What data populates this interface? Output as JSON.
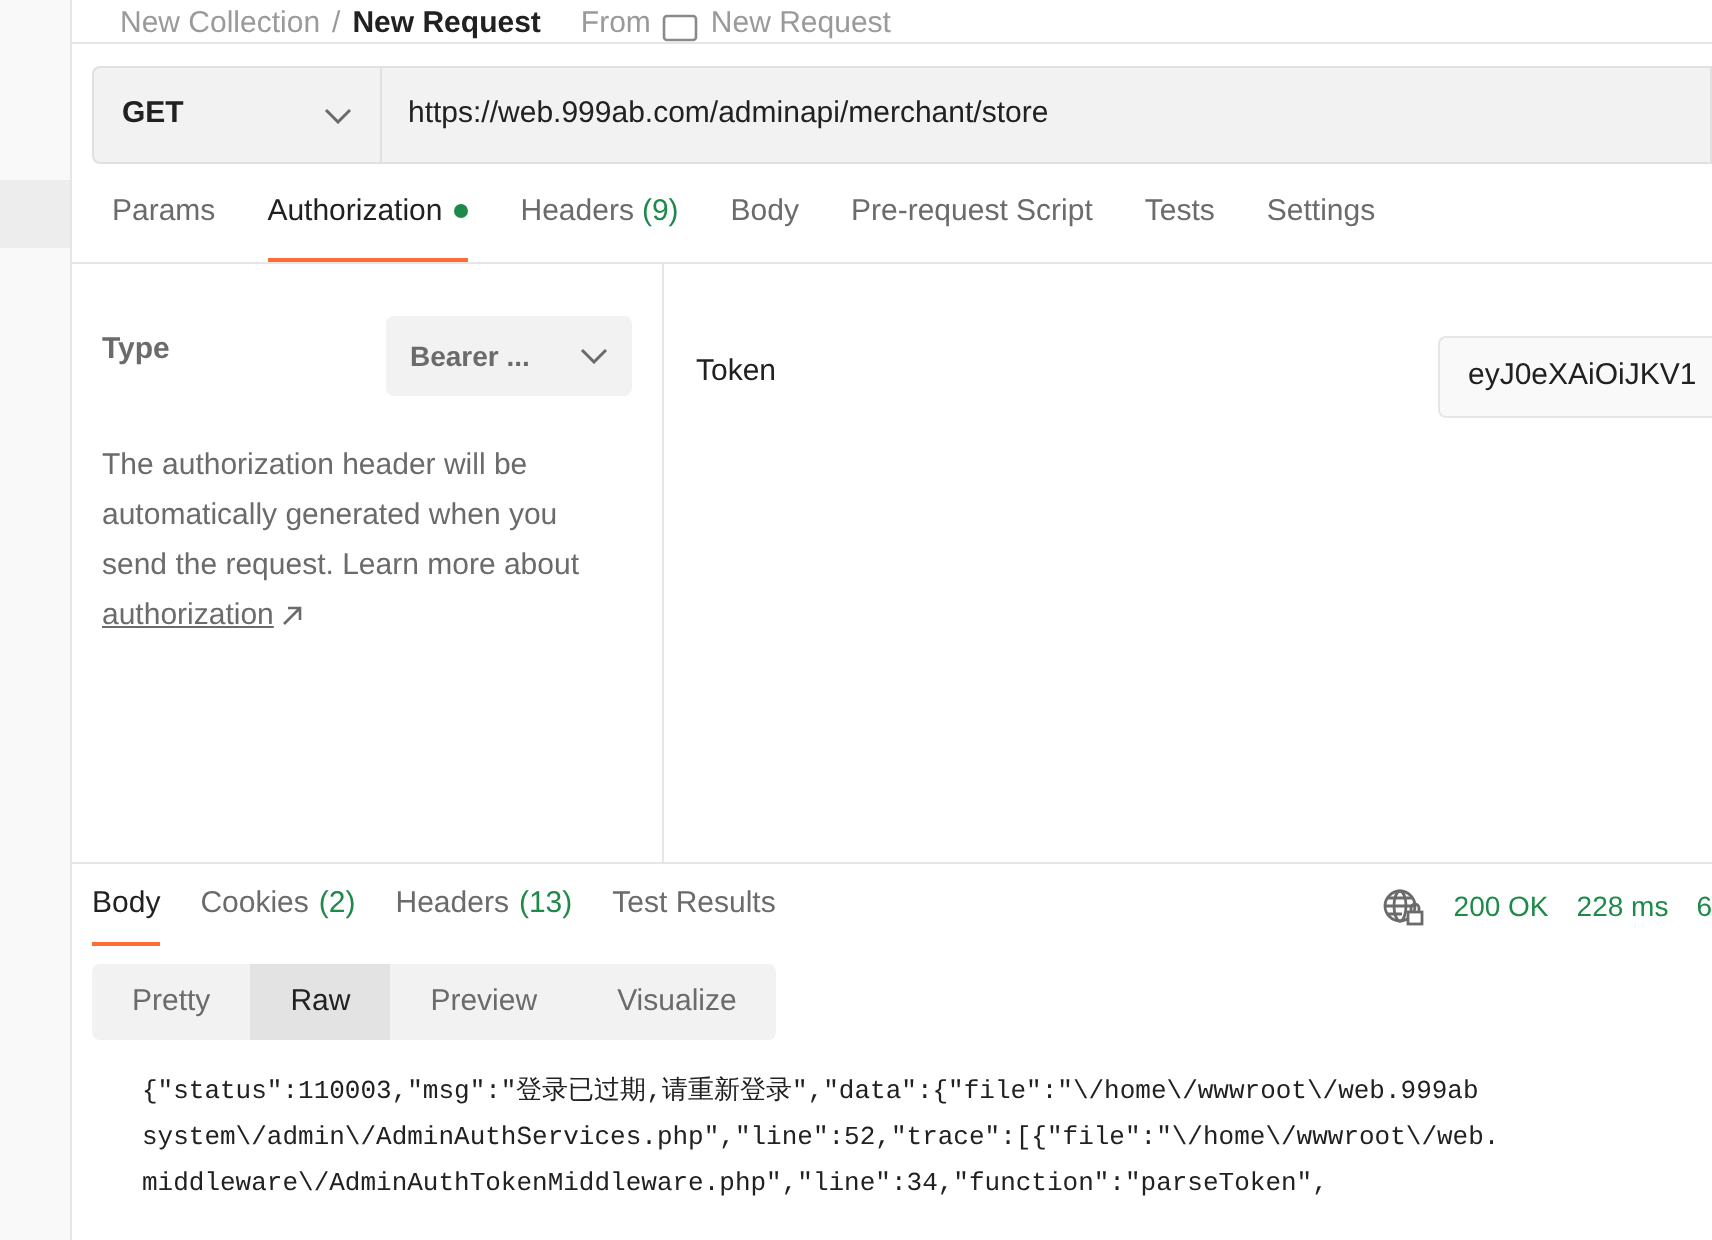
{
  "breadcrumb": {
    "collection": "New Collection",
    "separator": "/",
    "request": "New Request",
    "from_label": "From",
    "source": "New Request"
  },
  "request": {
    "method": "GET",
    "url": "https://web.999ab.com/adminapi/merchant/store"
  },
  "request_tabs": [
    {
      "label": "Params",
      "dot": false,
      "selected": false
    },
    {
      "label": "Authorization",
      "dot": true,
      "selected": true
    },
    {
      "label": "Headers",
      "count": "(9)",
      "dot": false,
      "selected": false
    },
    {
      "label": "Body",
      "dot": false,
      "selected": false
    },
    {
      "label": "Pre-request Script",
      "dot": false,
      "selected": false
    },
    {
      "label": "Tests",
      "dot": false,
      "selected": false
    },
    {
      "label": "Settings",
      "dot": false,
      "selected": false
    }
  ],
  "auth": {
    "type_label": "Type",
    "type_value": "Bearer ...",
    "description": "The authorization header will be automatically generated when you send the request. Learn more about",
    "link": "authorization",
    "token_label": "Token",
    "token_value": "eyJ0eXAiOiJKV1"
  },
  "response_tabs": [
    {
      "label": "Body",
      "selected": true
    },
    {
      "label": "Cookies",
      "count": "(2)",
      "selected": false
    },
    {
      "label": "Headers",
      "count": "(13)",
      "selected": false
    },
    {
      "label": "Test Results",
      "selected": false
    }
  ],
  "response_stats": {
    "status": "200 OK",
    "time": "228 ms",
    "size": "6"
  },
  "view_modes": [
    {
      "label": "Pretty",
      "selected": false
    },
    {
      "label": "Raw",
      "selected": true
    },
    {
      "label": "Preview",
      "selected": false
    },
    {
      "label": "Visualize",
      "selected": false
    }
  ],
  "body_lines": [
    "{\"status\":110003,\"msg\":\"登录已过期,请重新登录\",\"data\":{\"file\":\"\\/home\\/wwwroot\\/web.999ab",
    "system\\/admin\\/AdminAuthServices.php\",\"line\":52,\"trace\":[{\"file\":\"\\/home\\/wwwroot\\/web.",
    "middleware\\/AdminAuthTokenMiddleware.php\",\"line\":34,\"function\":\"parseToken\","
  ]
}
